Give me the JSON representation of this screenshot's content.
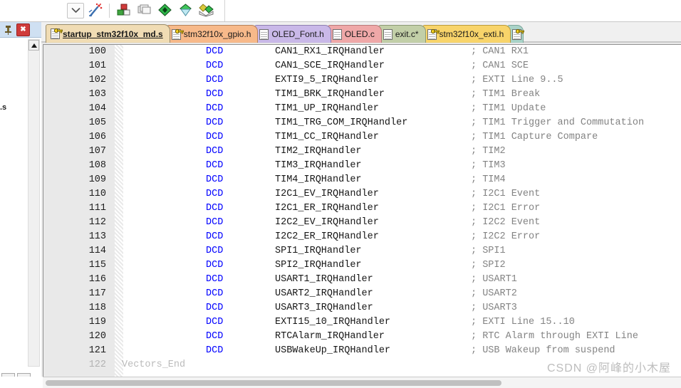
{
  "toolbar": {
    "buttons": [
      {
        "name": "dropdown-chevron",
        "icon": "chevron-down-icon"
      },
      {
        "name": "magic-wand",
        "icon": "magic-wand-icon"
      },
      {
        "name": "manage-components",
        "icon": "components-icon"
      },
      {
        "name": "windows",
        "icon": "windows-stack-icon"
      },
      {
        "name": "debug-green",
        "icon": "green-diamond-icon"
      },
      {
        "name": "analysis",
        "icon": "green-funnel-icon"
      },
      {
        "name": "packages",
        "icon": "green-packages-icon"
      }
    ]
  },
  "left_dock": {
    "pin_label": "pin-icon",
    "close_label": "✖",
    "vertical_label": ".s"
  },
  "tabs": [
    {
      "label": "startup_stm32f10x_md.s",
      "active": true,
      "has_key": true,
      "bg": "#f0dcb4",
      "border": "#9a8c6a"
    },
    {
      "label": "stm32f10x_gpio.h",
      "active": false,
      "has_key": true,
      "bg": "#f7b98a",
      "border": "#b4825b"
    },
    {
      "label": "OLED_Font.h",
      "active": false,
      "has_key": false,
      "bg": "#c9b8e8",
      "border": "#8e7fb0"
    },
    {
      "label": "OLED.c",
      "active": false,
      "has_key": false,
      "bg": "#efa8a8",
      "border": "#b87a7a"
    },
    {
      "label": "exit.c*",
      "active": false,
      "has_key": false,
      "bg": "#c2cfa8",
      "border": "#8d9a75"
    },
    {
      "label": "stm32f10x_exti.h",
      "active": false,
      "has_key": true,
      "bg": "#f8d46a",
      "border": "#bb9c3c"
    },
    {
      "label": "",
      "active": false,
      "has_key": true,
      "bg": "#a9d3c8",
      "border": "#7fa79c"
    }
  ],
  "editor": {
    "keyword": "DCD",
    "comment_marker": ";",
    "lines": [
      {
        "num": "100",
        "kw": "DCD",
        "sym": "CAN1_RX1_IRQHandler",
        "cmt": "; CAN1 RX1"
      },
      {
        "num": "101",
        "kw": "DCD",
        "sym": "CAN1_SCE_IRQHandler",
        "cmt": "; CAN1 SCE"
      },
      {
        "num": "102",
        "kw": "DCD",
        "sym": "EXTI9_5_IRQHandler",
        "cmt": "; EXTI Line 9..5"
      },
      {
        "num": "103",
        "kw": "DCD",
        "sym": "TIM1_BRK_IRQHandler",
        "cmt": "; TIM1 Break"
      },
      {
        "num": "104",
        "kw": "DCD",
        "sym": "TIM1_UP_IRQHandler",
        "cmt": "; TIM1 Update"
      },
      {
        "num": "105",
        "kw": "DCD",
        "sym": "TIM1_TRG_COM_IRQHandler",
        "cmt": "; TIM1 Trigger and Commutation"
      },
      {
        "num": "106",
        "kw": "DCD",
        "sym": "TIM1_CC_IRQHandler",
        "cmt": "; TIM1 Capture Compare"
      },
      {
        "num": "107",
        "kw": "DCD",
        "sym": "TIM2_IRQHandler",
        "cmt": "; TIM2"
      },
      {
        "num": "108",
        "kw": "DCD",
        "sym": "TIM3_IRQHandler",
        "cmt": "; TIM3"
      },
      {
        "num": "109",
        "kw": "DCD",
        "sym": "TIM4_IRQHandler",
        "cmt": "; TIM4"
      },
      {
        "num": "110",
        "kw": "DCD",
        "sym": "I2C1_EV_IRQHandler",
        "cmt": "; I2C1 Event"
      },
      {
        "num": "111",
        "kw": "DCD",
        "sym": "I2C1_ER_IRQHandler",
        "cmt": "; I2C1 Error"
      },
      {
        "num": "112",
        "kw": "DCD",
        "sym": "I2C2_EV_IRQHandler",
        "cmt": "; I2C2 Event"
      },
      {
        "num": "113",
        "kw": "DCD",
        "sym": "I2C2_ER_IRQHandler",
        "cmt": "; I2C2 Error"
      },
      {
        "num": "114",
        "kw": "DCD",
        "sym": "SPI1_IRQHandler",
        "cmt": "; SPI1"
      },
      {
        "num": "115",
        "kw": "DCD",
        "sym": "SPI2_IRQHandler",
        "cmt": "; SPI2"
      },
      {
        "num": "116",
        "kw": "DCD",
        "sym": "USART1_IRQHandler",
        "cmt": "; USART1"
      },
      {
        "num": "117",
        "kw": "DCD",
        "sym": "USART2_IRQHandler",
        "cmt": "; USART2"
      },
      {
        "num": "118",
        "kw": "DCD",
        "sym": "USART3_IRQHandler",
        "cmt": "; USART3"
      },
      {
        "num": "119",
        "kw": "DCD",
        "sym": "EXTI15_10_IRQHandler",
        "cmt": "; EXTI Line 15..10"
      },
      {
        "num": "120",
        "kw": "DCD",
        "sym": "RTCAlarm_IRQHandler",
        "cmt": "; RTC Alarm through EXTI Line"
      },
      {
        "num": "121",
        "kw": "DCD",
        "sym": "USBWakeUp_IRQHandler",
        "cmt": "; USB Wakeup from suspend"
      }
    ],
    "partial_line": {
      "num": "122",
      "sym": "Vectors_End",
      "kw": "",
      "cmt": ""
    }
  },
  "watermark": {
    "text": "CSDN @阿峰的小木屋"
  }
}
